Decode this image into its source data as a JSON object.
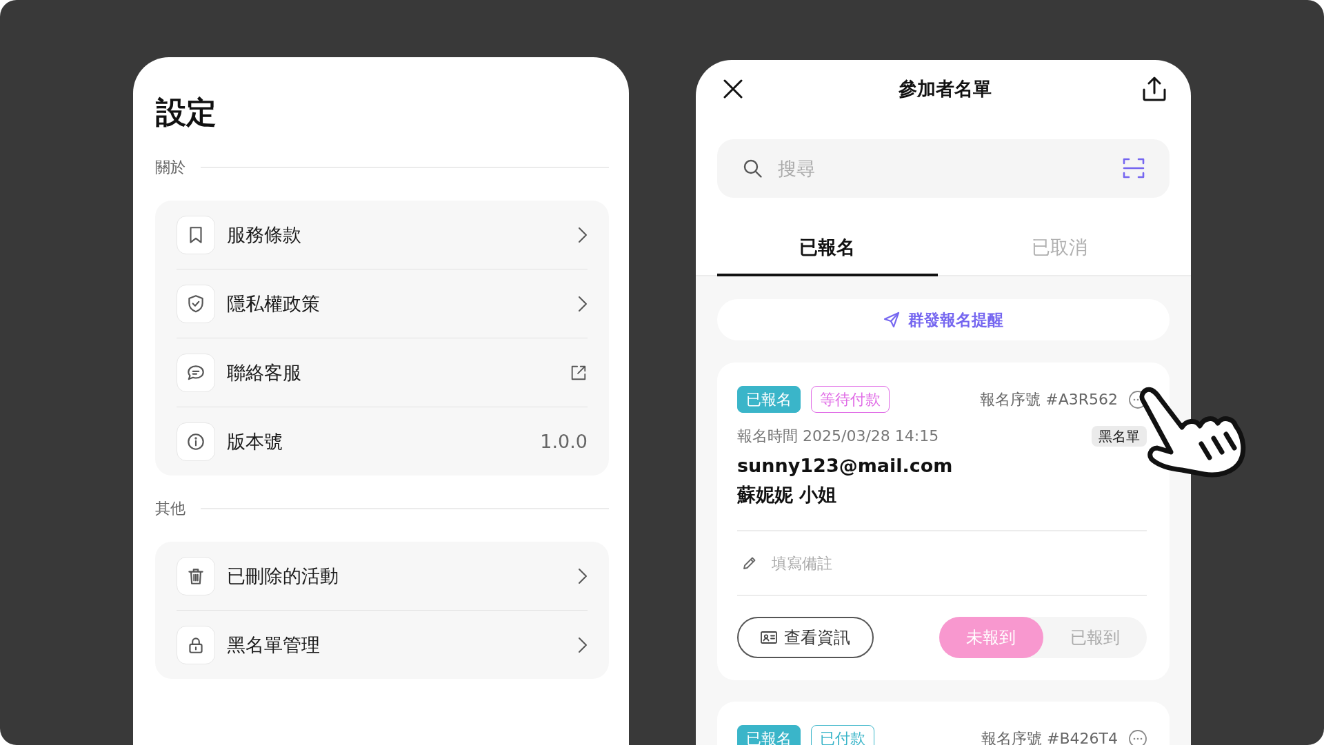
{
  "settings": {
    "title": "設定",
    "sections": [
      {
        "label": "關於",
        "items": [
          {
            "label": "服務條款",
            "kind": "link"
          },
          {
            "label": "隱私權政策",
            "kind": "link"
          },
          {
            "label": "聯絡客服",
            "kind": "external"
          },
          {
            "label": "版本號",
            "kind": "value",
            "value": "1.0.0"
          }
        ]
      },
      {
        "label": "其他",
        "items": [
          {
            "label": "已刪除的活動",
            "kind": "link"
          },
          {
            "label": "黑名單管理",
            "kind": "link"
          }
        ]
      }
    ]
  },
  "participants": {
    "title": "參加者名單",
    "search": {
      "placeholder": "搜尋"
    },
    "tabs": [
      {
        "label": "已報名",
        "selected": true
      },
      {
        "label": "已取消",
        "selected": false
      }
    ],
    "broadcast_button": "群發報名提醒",
    "cards": [
      {
        "tags": [
          {
            "label": "已報名",
            "kind": "filled",
            "color": "#3ab5c9"
          },
          {
            "label": "等待付款",
            "kind": "outline",
            "color": "#e06ce6"
          }
        ],
        "serial": "報名序號 #A3R562",
        "time": "報名時間 2025/03/28 14:15",
        "badge": "黑名單",
        "email": "sunny123@mail.com",
        "name": "蘇妮妮 小姐",
        "note": {
          "placeholder": "填寫備註"
        },
        "info_button": "查看資訊",
        "checkin": [
          {
            "label": "未報到",
            "selected": true
          },
          {
            "label": "已報到",
            "selected": false
          }
        ]
      },
      {
        "tags": [
          {
            "label": "已報名",
            "kind": "filled",
            "color": "#3ab5c9"
          },
          {
            "label": "已付款",
            "kind": "outline",
            "color": "#3ab5c9"
          }
        ],
        "serial": "報名序號 #B426T4"
      }
    ]
  }
}
